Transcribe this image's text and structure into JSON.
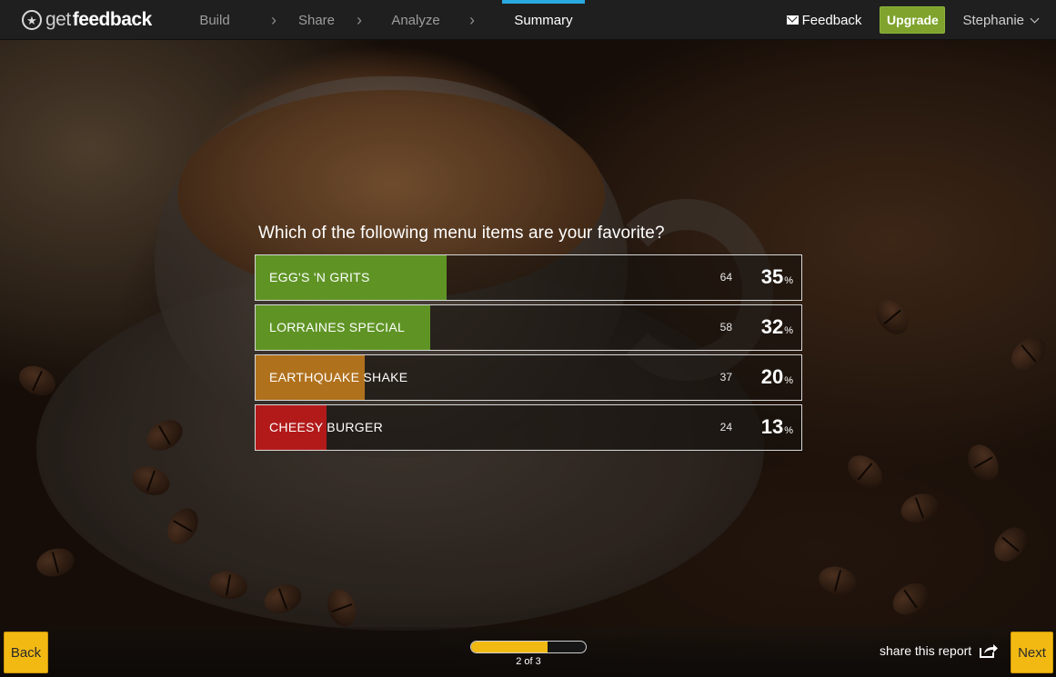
{
  "app": {
    "logo_get": "get",
    "logo_feedback": "feedback"
  },
  "nav": {
    "tabs": [
      {
        "label": "Build"
      },
      {
        "label": "Share"
      },
      {
        "label": "Analyze"
      },
      {
        "label": "Summary",
        "active": true
      }
    ],
    "separator": "›"
  },
  "header_right": {
    "feedback_label": "Feedback",
    "upgrade_label": "Upgrade",
    "user_name": "Stephanie"
  },
  "survey": {
    "question": "Which of the following menu items are your favorite?",
    "unit": "%",
    "results": [
      {
        "label": "EGG'S 'N GRITS",
        "count": "64",
        "percent": "35",
        "color": "#5f9425"
      },
      {
        "label": "LORRAINES SPECIAL",
        "count": "58",
        "percent": "32",
        "color": "#5f9425"
      },
      {
        "label": "EARTHQUAKE SHAKE",
        "count": "37",
        "percent": "20",
        "color": "#b0711d"
      },
      {
        "label": "CHEESY BURGER",
        "count": "24",
        "percent": "13",
        "color": "#b21a1a"
      }
    ]
  },
  "footer": {
    "back_label": "Back",
    "next_label": "Next",
    "page_indicator": "2 of 3",
    "progress_fraction": 0.67,
    "share_label": "share this report"
  },
  "colors": {
    "accent": "#2aa9e0",
    "upgrade": "#7fa32c",
    "button_yellow": "#f2b913"
  }
}
